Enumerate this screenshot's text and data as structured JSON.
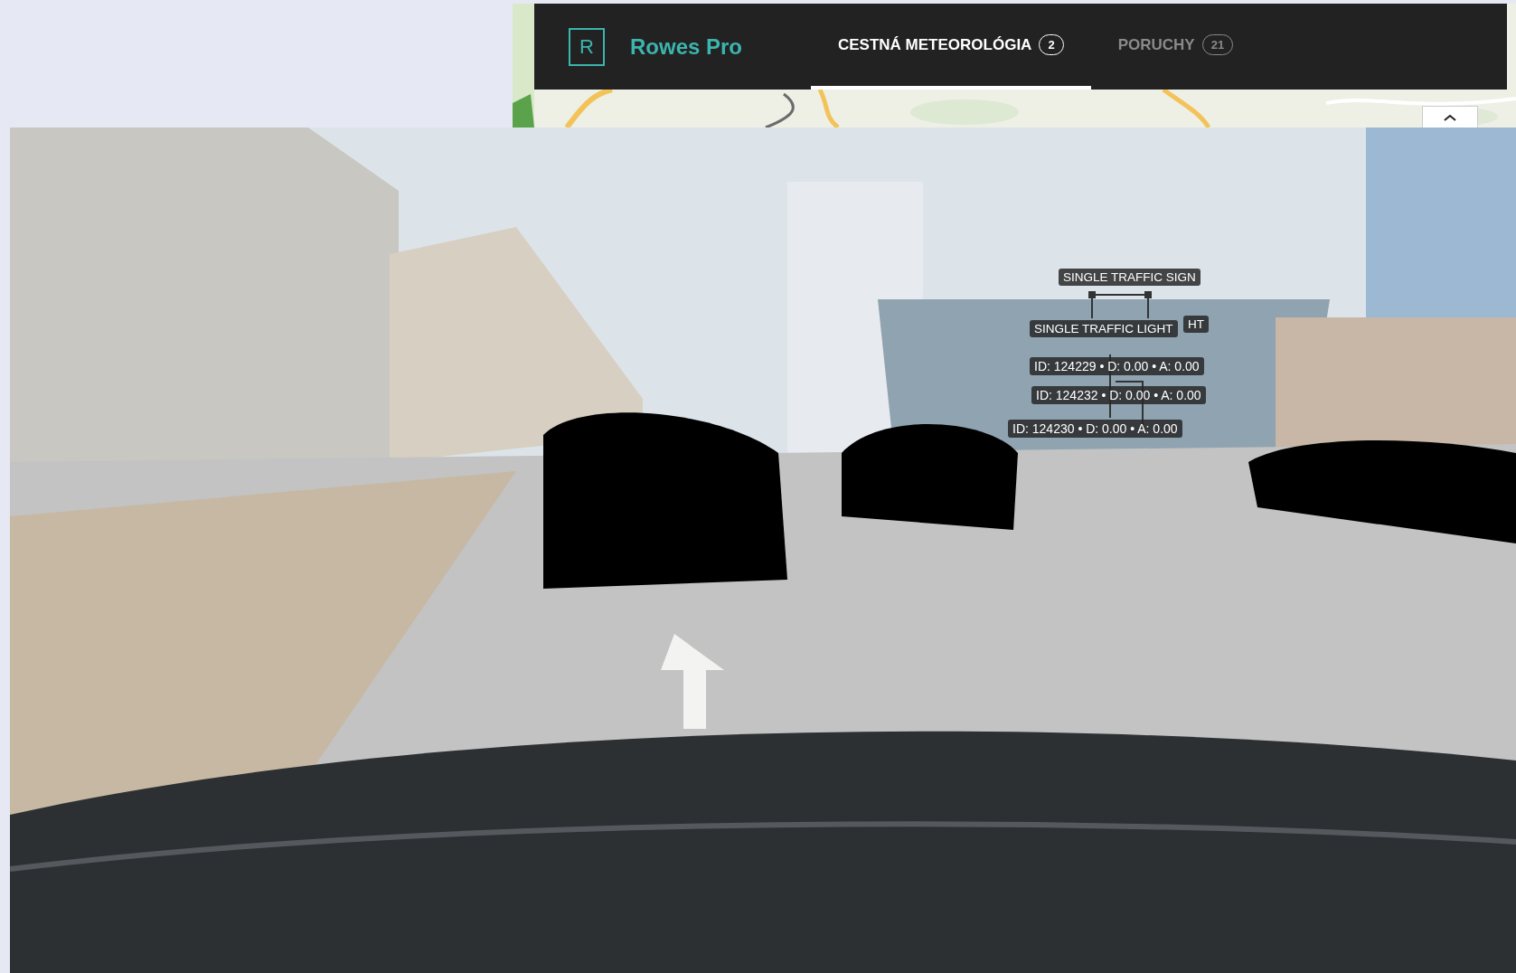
{
  "app": {
    "logo": "R",
    "name": "Rowes Pro"
  },
  "tabs": [
    {
      "label": "CESTNÁ METEOROLÓGIA",
      "count": "2",
      "selected": true
    },
    {
      "label": "PORUCHY",
      "count": "21",
      "selected": false
    }
  ],
  "video": {
    "kind": "picture",
    "detections": [
      {
        "kind": "class",
        "text": "SINGLE TRAFFIC SIGN"
      },
      {
        "kind": "class",
        "text": "SINGLE TRAFFIC LIGHT"
      },
      {
        "kind": "class",
        "text": "HT"
      },
      {
        "kind": "info",
        "text": "ID: 124229 • D: 0.00 • A: 0.00"
      },
      {
        "kind": "info",
        "text": "ID: 124232 • D: 0.00 • A: 0.00"
      },
      {
        "kind": "info",
        "text": "ID: 124230 • D: 0.00 • A: 0.00"
      }
    ]
  }
}
